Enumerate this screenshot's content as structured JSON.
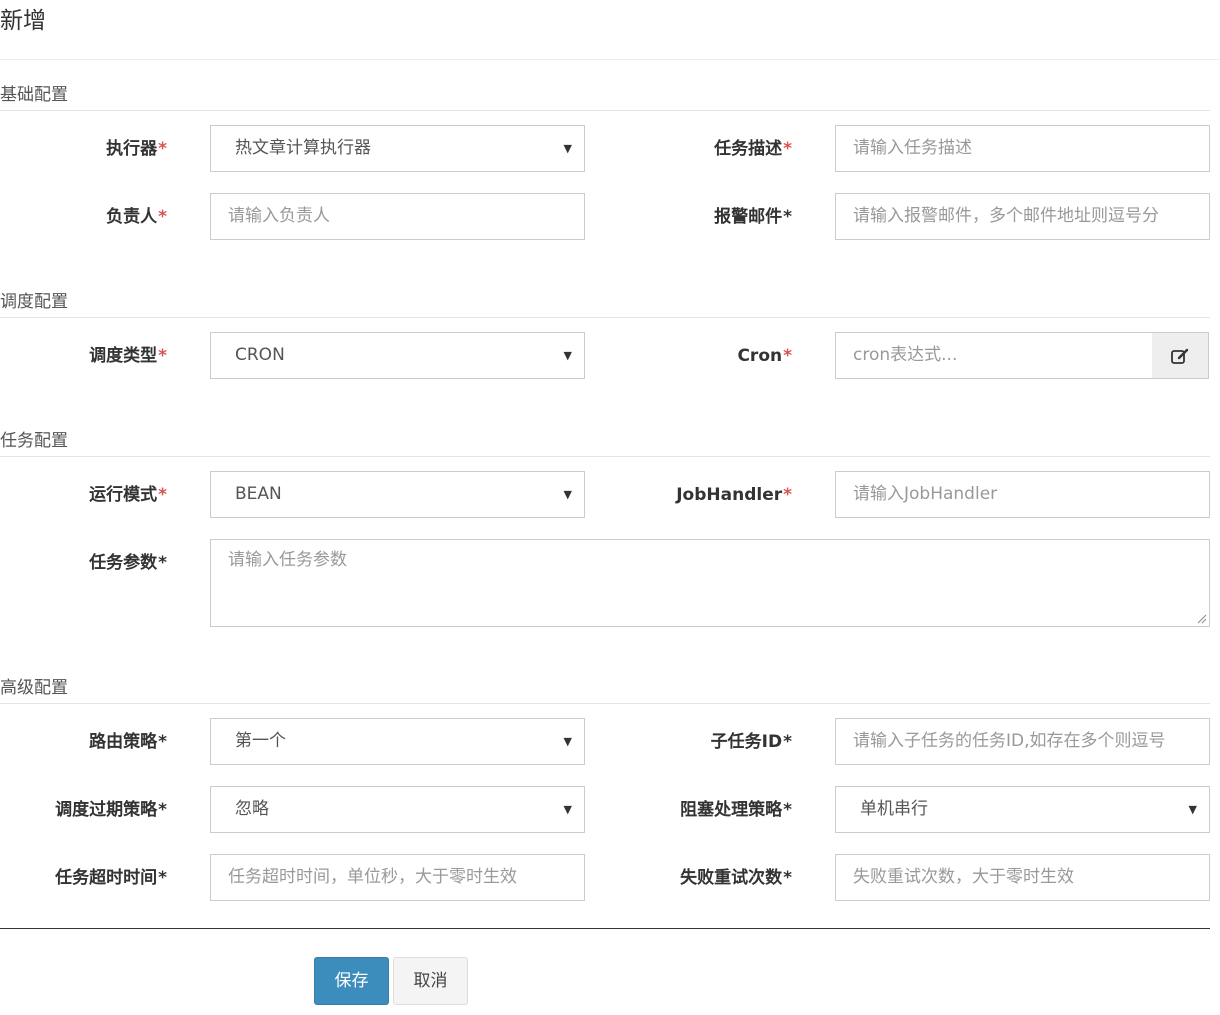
{
  "modal": {
    "title": "新增"
  },
  "sections": {
    "basic": "基础配置",
    "schedule": "调度配置",
    "task": "任务配置",
    "advanced": "高级配置"
  },
  "fields": {
    "executor": {
      "label": "执行器",
      "value": "热文章计算执行器"
    },
    "task_desc": {
      "label": "任务描述",
      "placeholder": "请输入任务描述"
    },
    "owner": {
      "label": "负责人",
      "placeholder": "请输入负责人"
    },
    "alarm_email": {
      "label": "报警邮件",
      "placeholder": "请输入报警邮件，多个邮件地址则逗号分"
    },
    "schedule_type": {
      "label": "调度类型",
      "value": "CRON"
    },
    "cron": {
      "label": "Cron",
      "placeholder": "cron表达式...",
      "icon": "edit-icon"
    },
    "run_mode": {
      "label": "运行模式",
      "value": "BEAN"
    },
    "job_handler": {
      "label": "JobHandler",
      "placeholder": "请输入JobHandler"
    },
    "task_params": {
      "label": "任务参数",
      "placeholder": "请输入任务参数"
    },
    "route_strategy": {
      "label": "路由策略",
      "value": "第一个"
    },
    "child_task_id": {
      "label": "子任务ID",
      "placeholder": "请输入子任务的任务ID,如存在多个则逗号"
    },
    "misfire_strategy": {
      "label": "调度过期策略",
      "value": "忽略"
    },
    "block_strategy": {
      "label": "阻塞处理策略",
      "value": "单机串行"
    },
    "timeout": {
      "label": "任务超时时间",
      "placeholder": "任务超时时间，单位秒，大于零时生效"
    },
    "retry_count": {
      "label": "失败重试次数",
      "placeholder": "失败重试次数，大于零时生效"
    }
  },
  "required_mark": "*",
  "buttons": {
    "save": "保存",
    "cancel": "取消"
  },
  "colors": {
    "required": "#d9534f",
    "primary": "#3c8dbc",
    "border": "#cccccc",
    "placeholder": "#999999"
  }
}
